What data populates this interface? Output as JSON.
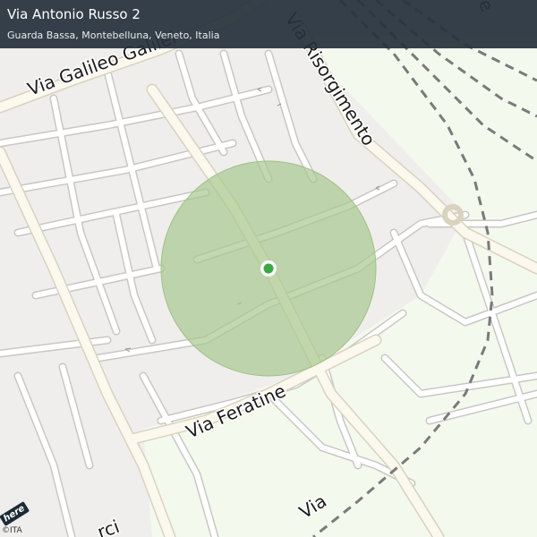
{
  "header": {
    "title": "Via Antonio Russo 2",
    "subtitle": "Guarda Bassa, Montebelluna, Veneto, Italia"
  },
  "map": {
    "streets": [
      {
        "name": "Via  Galileo  Galilei"
      },
      {
        "name": "Via  Risorgimento"
      },
      {
        "name": "Via  Feratine"
      },
      {
        "name": "Via"
      },
      {
        "name": "rci"
      },
      {
        "name": "e"
      }
    ],
    "accuracy_circle_color": "#a8c88f",
    "location_marker_color": "#3aa845",
    "park_color": "#f3f9ec",
    "railway_color": "#6f6f6f"
  },
  "footer": {
    "brand": "here",
    "copyright": "©ITA"
  }
}
